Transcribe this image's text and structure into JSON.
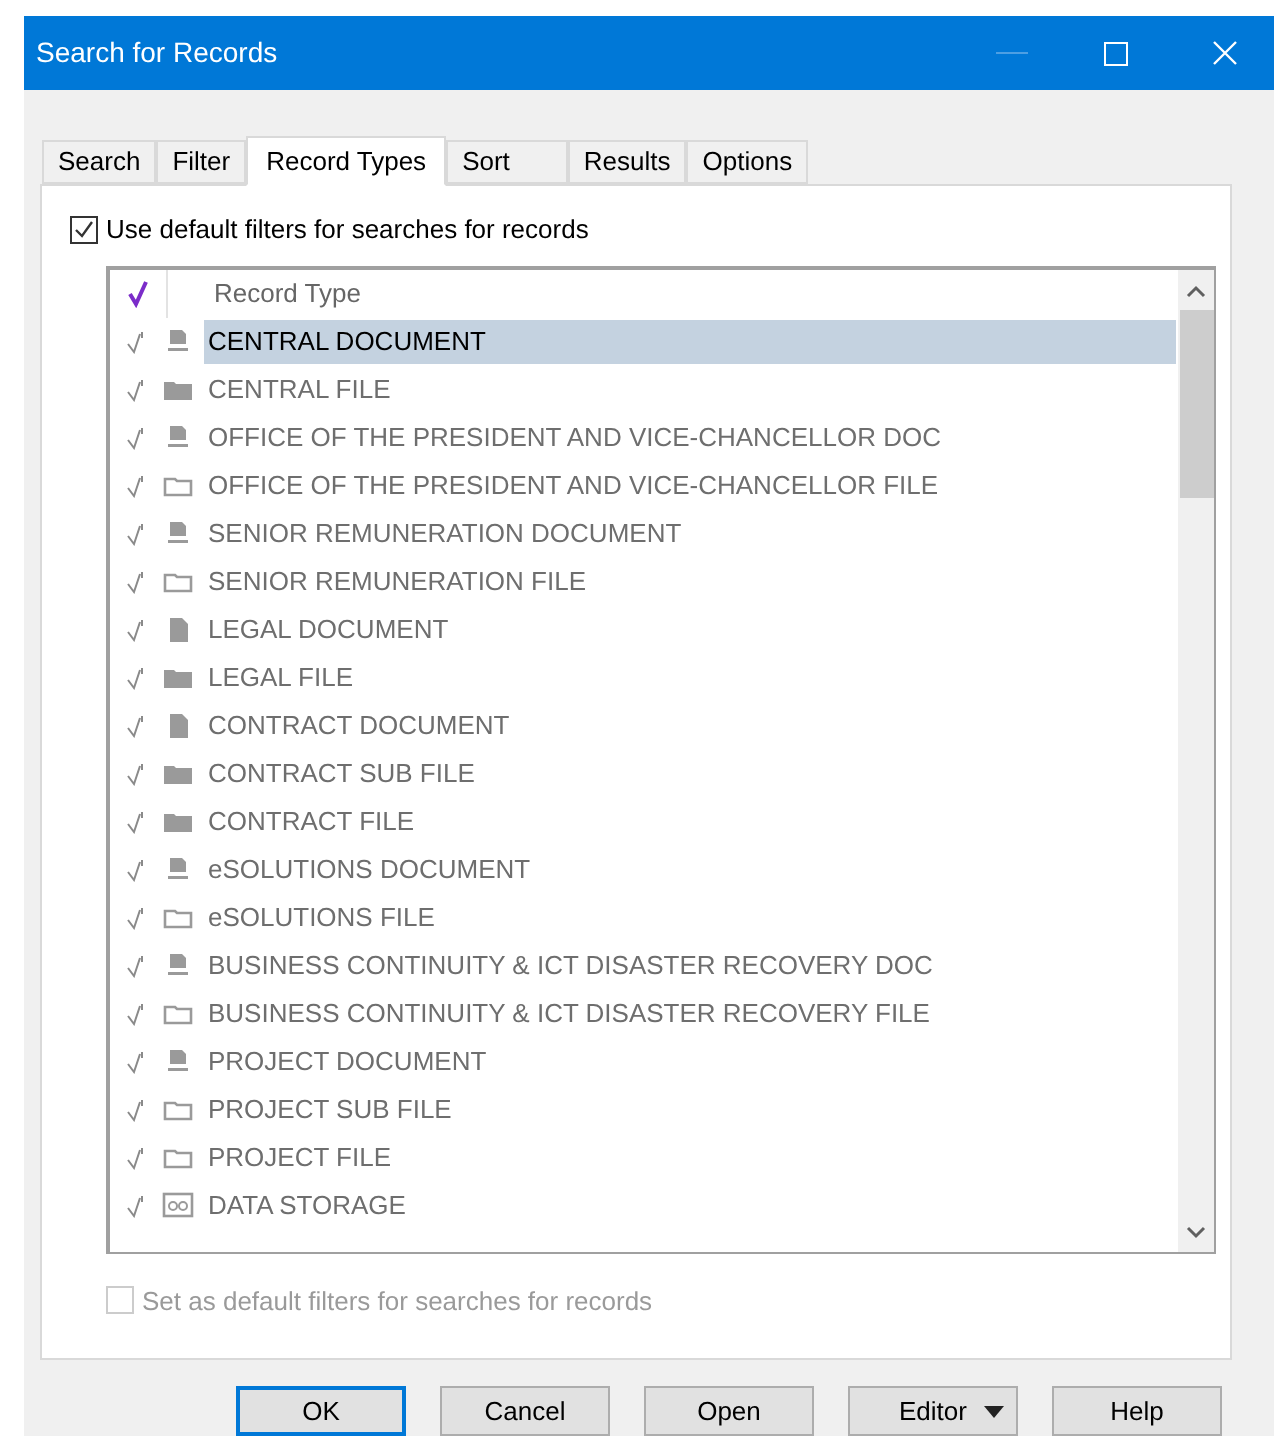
{
  "window": {
    "title": "Search for Records"
  },
  "tabs": [
    {
      "label": "Search",
      "selected": false
    },
    {
      "label": "Filter",
      "selected": false
    },
    {
      "label": "Record Types",
      "selected": true
    },
    {
      "label": "Sort",
      "selected": false
    },
    {
      "label": "Results",
      "selected": false
    },
    {
      "label": "Options",
      "selected": false
    }
  ],
  "use_default": {
    "label": "Use default filters for searches for records",
    "checked": true,
    "disabled": false
  },
  "list": {
    "column": "Record Type",
    "rows": [
      {
        "label": "CENTRAL DOCUMENT",
        "kind": "document",
        "checked": true,
        "selected": true
      },
      {
        "label": "CENTRAL FILE",
        "kind": "folder",
        "checked": true,
        "selected": false
      },
      {
        "label": "OFFICE OF THE PRESIDENT AND VICE-CHANCELLOR DOC",
        "kind": "document",
        "checked": true,
        "selected": false
      },
      {
        "label": "OFFICE OF THE PRESIDENT AND VICE-CHANCELLOR FILE",
        "kind": "folder-outline",
        "checked": true,
        "selected": false
      },
      {
        "label": "SENIOR REMUNERATION DOCUMENT",
        "kind": "document",
        "checked": true,
        "selected": false
      },
      {
        "label": "SENIOR REMUNERATION FILE",
        "kind": "folder-outline",
        "checked": true,
        "selected": false
      },
      {
        "label": "LEGAL DOCUMENT",
        "kind": "page",
        "checked": true,
        "selected": false
      },
      {
        "label": "LEGAL FILE",
        "kind": "folder",
        "checked": true,
        "selected": false
      },
      {
        "label": "CONTRACT DOCUMENT",
        "kind": "page",
        "checked": true,
        "selected": false
      },
      {
        "label": "CONTRACT SUB FILE",
        "kind": "folder",
        "checked": true,
        "selected": false
      },
      {
        "label": "CONTRACT FILE",
        "kind": "folder",
        "checked": true,
        "selected": false
      },
      {
        "label": "eSOLUTIONS DOCUMENT",
        "kind": "document",
        "checked": true,
        "selected": false
      },
      {
        "label": "eSOLUTIONS FILE",
        "kind": "folder-outline",
        "checked": true,
        "selected": false
      },
      {
        "label": "BUSINESS CONTINUITY & ICT DISASTER RECOVERY DOC",
        "kind": "document",
        "checked": true,
        "selected": false
      },
      {
        "label": "BUSINESS CONTINUITY & ICT DISASTER RECOVERY FILE",
        "kind": "folder-outline",
        "checked": true,
        "selected": false
      },
      {
        "label": "PROJECT DOCUMENT",
        "kind": "document",
        "checked": true,
        "selected": false
      },
      {
        "label": "PROJECT SUB FILE",
        "kind": "folder-outline",
        "checked": true,
        "selected": false
      },
      {
        "label": "PROJECT FILE",
        "kind": "folder-outline",
        "checked": true,
        "selected": false
      },
      {
        "label": "DATA STORAGE",
        "kind": "storage",
        "checked": true,
        "selected": false
      }
    ]
  },
  "set_default": {
    "label": "Set as default filters for searches for records",
    "checked": false,
    "disabled": true
  },
  "buttons": [
    {
      "label": "OK",
      "kind": "default"
    },
    {
      "label": "Cancel",
      "kind": "plain"
    },
    {
      "label": "Open",
      "kind": "plain"
    },
    {
      "label": "Editor",
      "kind": "dropdown"
    },
    {
      "label": "Help",
      "kind": "plain"
    }
  ]
}
